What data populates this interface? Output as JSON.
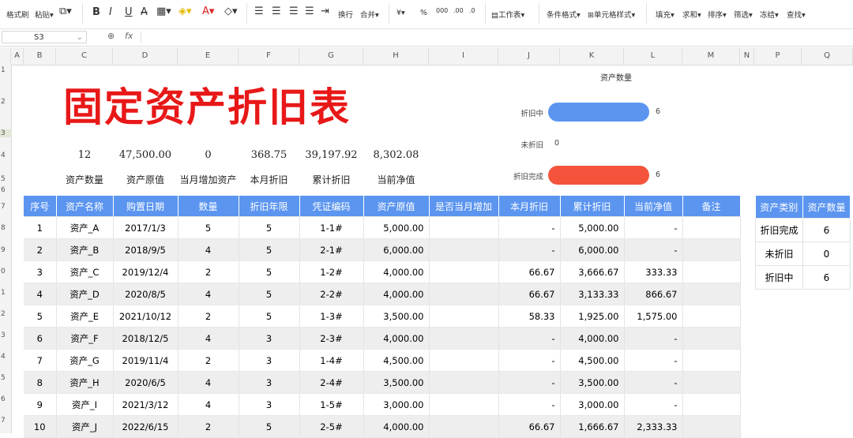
{
  "toolbar": {
    "format_painter": "格式刷",
    "paste": "粘贴",
    "bold": "B",
    "italic": "I",
    "underline": "U",
    "strike": "A",
    "wrap": "换行",
    "merge": "合并",
    "currency": "¥",
    "percent": "%",
    "worksheet": "工作表",
    "cond_format": "条件格式",
    "cell_style": "单元格样式",
    "fill": "填充",
    "sum": "求和",
    "sort": "排序",
    "filter": "筛选",
    "freeze": "冻结",
    "find": "查找"
  },
  "formula_bar": {
    "name_box": "S3",
    "fx": "fx"
  },
  "columns": [
    "A",
    "B",
    "C",
    "D",
    "E",
    "F",
    "G",
    "H",
    "I",
    "J",
    "K",
    "L",
    "M",
    "N",
    "P",
    "Q"
  ],
  "rows": [
    "1",
    "2",
    "3",
    "4",
    "5",
    "6",
    "7",
    "8",
    "9",
    "0",
    "1",
    "2",
    "3",
    "4",
    "5",
    "6",
    "7"
  ],
  "title": "固定资产折旧表",
  "summary": [
    {
      "value": "12",
      "label": "资产数量"
    },
    {
      "value": "47,500.00",
      "label": "资产原值"
    },
    {
      "value": "0",
      "label": "当月增加资产"
    },
    {
      "value": "368.75",
      "label": "本月折旧"
    },
    {
      "value": "39,197.92",
      "label": "累计折旧"
    },
    {
      "value": "8,302.08",
      "label": "当前净值"
    }
  ],
  "table": {
    "headers": [
      "序号",
      "资产名称",
      "购置日期",
      "数量",
      "折旧年限",
      "凭证编码",
      "资产原值",
      "是否当月增加",
      "本月折旧",
      "累计折旧",
      "当前净值",
      "备注"
    ],
    "rows": [
      [
        "1",
        "资产_A",
        "2017/1/3",
        "5",
        "5",
        "1-1#",
        "5,000.00",
        "",
        "-",
        "5,000.00",
        "-",
        ""
      ],
      [
        "2",
        "资产_B",
        "2018/9/5",
        "4",
        "5",
        "2-1#",
        "6,000.00",
        "",
        "-",
        "6,000.00",
        "-",
        ""
      ],
      [
        "3",
        "资产_C",
        "2019/12/4",
        "2",
        "5",
        "1-2#",
        "4,000.00",
        "",
        "66.67",
        "3,666.67",
        "333.33",
        ""
      ],
      [
        "4",
        "资产_D",
        "2020/8/5",
        "4",
        "5",
        "2-2#",
        "4,000.00",
        "",
        "66.67",
        "3,133.33",
        "866.67",
        ""
      ],
      [
        "5",
        "资产_E",
        "2021/10/12",
        "2",
        "5",
        "1-3#",
        "3,500.00",
        "",
        "58.33",
        "1,925.00",
        "1,575.00",
        ""
      ],
      [
        "6",
        "资产_F",
        "2018/12/5",
        "4",
        "3",
        "2-3#",
        "4,000.00",
        "",
        "-",
        "4,000.00",
        "-",
        ""
      ],
      [
        "7",
        "资产_G",
        "2019/11/4",
        "2",
        "3",
        "1-4#",
        "4,500.00",
        "",
        "-",
        "4,500.00",
        "-",
        ""
      ],
      [
        "8",
        "资产_H",
        "2020/6/5",
        "4",
        "3",
        "2-4#",
        "3,500.00",
        "",
        "-",
        "3,500.00",
        "-",
        ""
      ],
      [
        "9",
        "资产_I",
        "2021/3/12",
        "4",
        "3",
        "1-5#",
        "3,000.00",
        "",
        "-",
        "3,000.00",
        "-",
        ""
      ],
      [
        "10",
        "资产_J",
        "2022/6/15",
        "2",
        "5",
        "2-5#",
        "4,000.00",
        "",
        "66.67",
        "1,666.67",
        "2,333.33",
        ""
      ]
    ]
  },
  "side_table": {
    "headers": [
      "资产类别",
      "资产数量"
    ],
    "rows": [
      [
        "折旧完成",
        "6"
      ],
      [
        "未折旧",
        "0"
      ],
      [
        "折旧中",
        "6"
      ]
    ]
  },
  "chart_data": {
    "type": "bar",
    "title": "资产数量",
    "categories": [
      "折旧中",
      "未折旧",
      "折旧完成"
    ],
    "values": [
      6,
      0,
      6
    ],
    "colors": [
      "#5b95f0",
      "#5b95f0",
      "#f4543c"
    ],
    "xlim": [
      0,
      6
    ]
  }
}
